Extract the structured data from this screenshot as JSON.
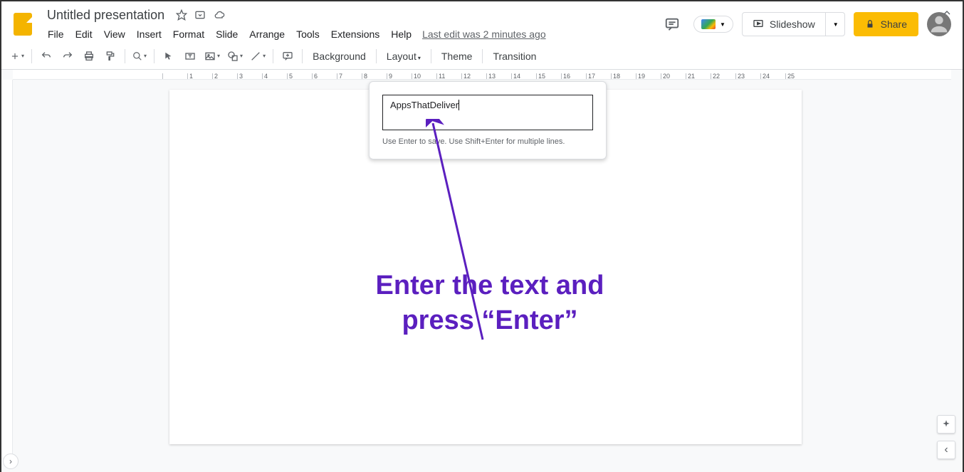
{
  "header": {
    "doc_title": "Untitled presentation",
    "last_edit": "Last edit was 2 minutes ago",
    "slideshow_label": "Slideshow",
    "share_label": "Share"
  },
  "menus": {
    "file": "File",
    "edit": "Edit",
    "view": "View",
    "insert": "Insert",
    "format": "Format",
    "slide": "Slide",
    "arrange": "Arrange",
    "tools": "Tools",
    "extensions": "Extensions",
    "help": "Help"
  },
  "toolbar": {
    "background": "Background",
    "layout": "Layout",
    "theme": "Theme",
    "transition": "Transition"
  },
  "ruler": [
    "",
    "1",
    "2",
    "3",
    "4",
    "5",
    "6",
    "7",
    "8",
    "9",
    "10",
    "11",
    "12",
    "13",
    "14",
    "15",
    "16",
    "17",
    "18",
    "19",
    "20",
    "21",
    "22",
    "23",
    "24",
    "25"
  ],
  "popup": {
    "input_value": "AppsThatDeliver",
    "hint": "Use Enter to save. Use Shift+Enter for multiple lines."
  },
  "annotation": {
    "text_line1": "Enter the text and",
    "text_line2": "press “Enter”"
  }
}
